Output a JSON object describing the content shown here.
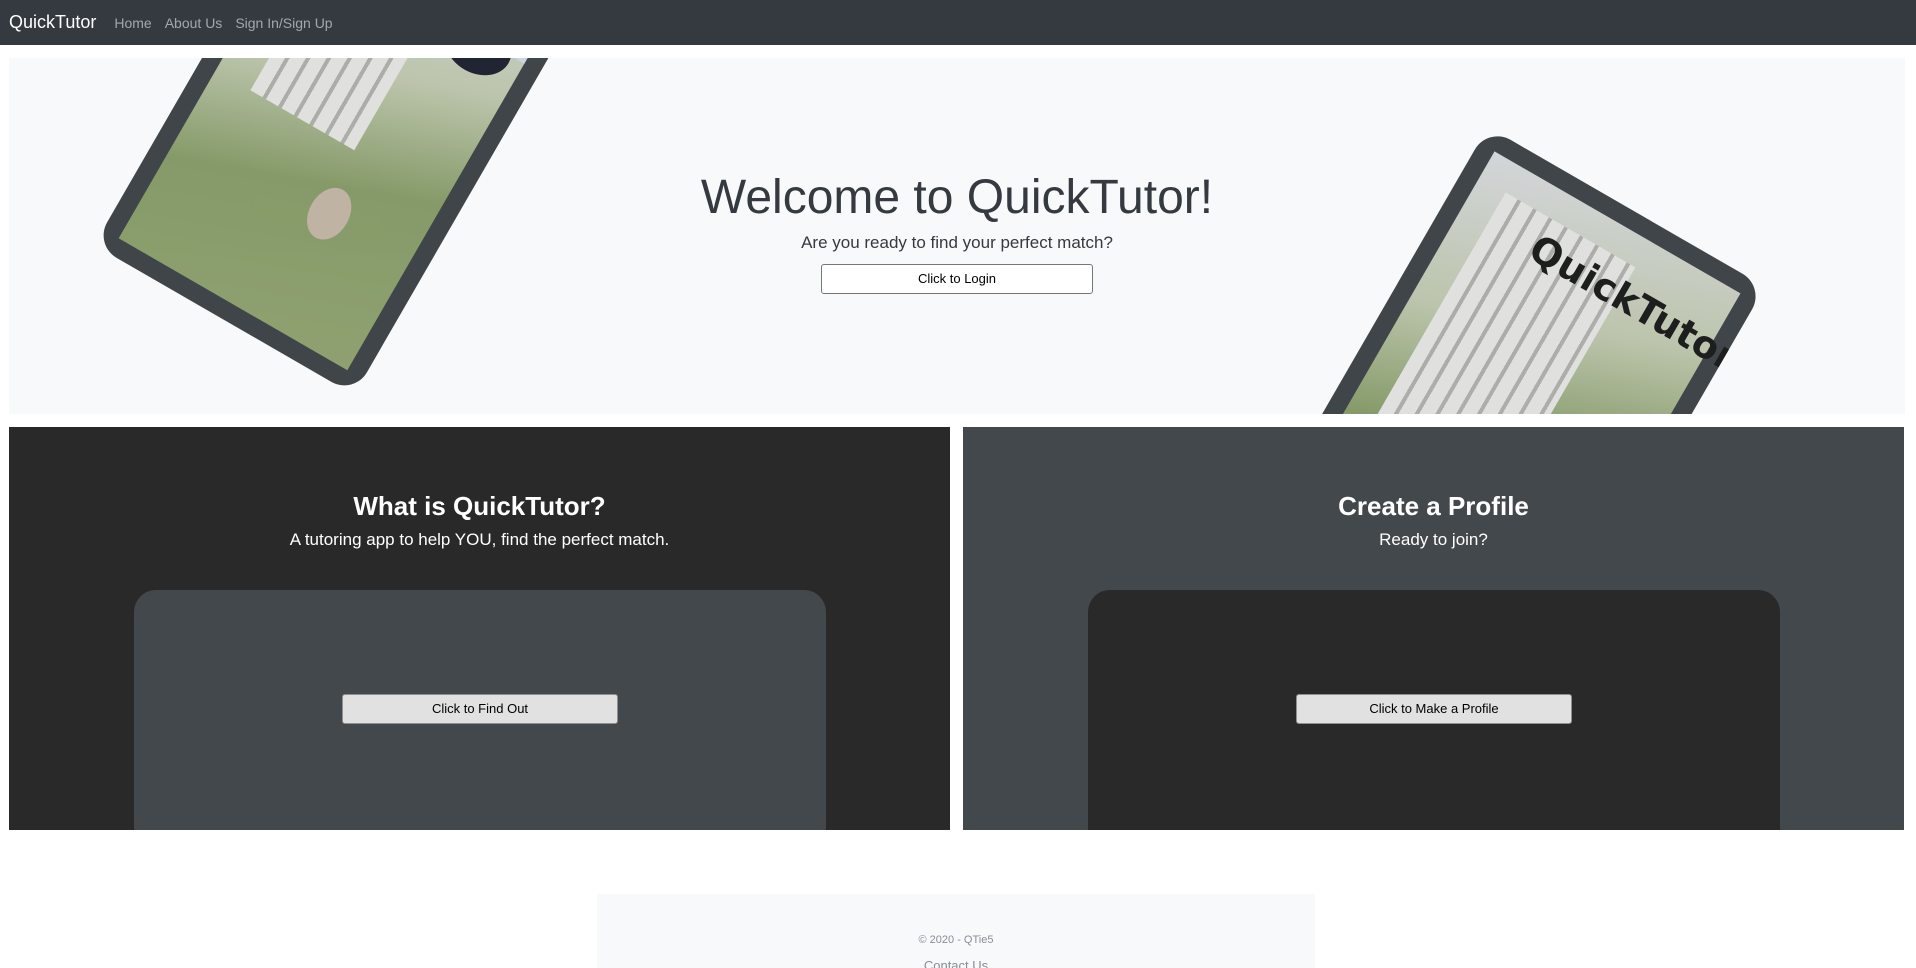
{
  "navbar": {
    "brand": "QuickTutor",
    "links": [
      "Home",
      "About Us",
      "Sign In/Sign Up"
    ]
  },
  "hero": {
    "title": "Welcome to QuickTutor!",
    "subtitle": "Are you ready to find your perfect match?",
    "login_button": "Click to Login",
    "tablet_logo_text": "QuickTutor"
  },
  "panels": [
    {
      "title": "What is QuickTutor?",
      "subtitle": "A tutoring app to help YOU, find the perfect match.",
      "button": "Click to Find Out"
    },
    {
      "title": "Create a Profile",
      "subtitle": "Ready to join?",
      "button": "Click to Make a Profile"
    }
  ],
  "footer": {
    "copyright": "© 2020 - QTie5",
    "contact": "Contact Us"
  },
  "colors": {
    "navbar": "#343a40",
    "hero_bg": "#f8f9fa",
    "panel_dark": "#292929",
    "panel_gray": "#43484c"
  }
}
